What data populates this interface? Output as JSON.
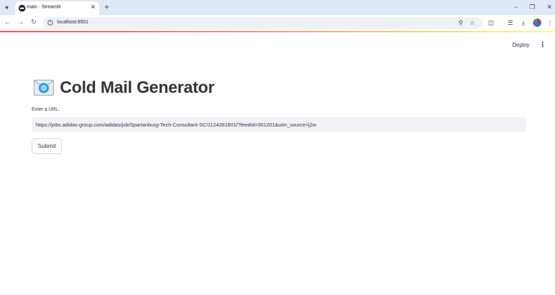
{
  "browser": {
    "tab": {
      "title": "main · Streamlit"
    },
    "address_bar": {
      "url": "localhost:8501"
    }
  },
  "header": {
    "deploy_label": "Deploy"
  },
  "main": {
    "title": "Cold Mail Generator",
    "url_input": {
      "label": "Enter a URL:",
      "value": "https://jobs.adidas-group.com/adidas/job/Spartanburg-Tech-Consultant-SC/1124281801/?feedId=301201&utm_source=j2w"
    },
    "submit_label": "Submit"
  },
  "icons": {
    "title_icon": "incoming-envelope-emoji",
    "tab_favicon": "streamlit-icon"
  },
  "colors": {
    "text": "#31333f",
    "input_background": "#f0f2f6",
    "tabstrip_background": "#dfe8f6",
    "decoration_gradient_start": "#ff4b4b",
    "decoration_gradient_end": "#fffd80"
  }
}
